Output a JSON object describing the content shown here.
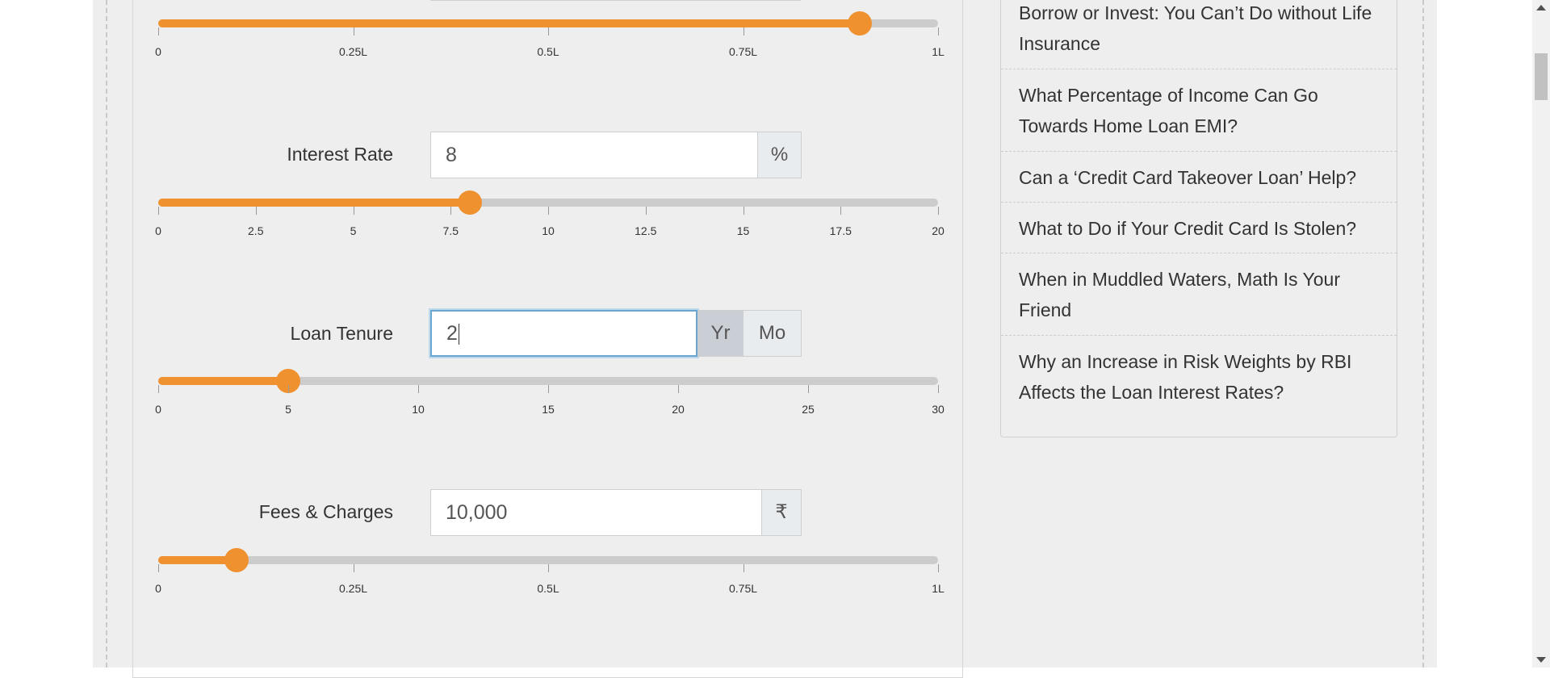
{
  "sliders": [
    {
      "id": "loan-amount",
      "label": "",
      "value_fraction": 0.9,
      "ticks": [
        "0",
        "0.25L",
        "0.5L",
        "0.75L",
        "1L"
      ]
    },
    {
      "id": "interest-rate",
      "label": "Interest Rate",
      "input_value": "8",
      "addon": "%",
      "value_fraction": 0.4,
      "ticks": [
        "0",
        "2.5",
        "5",
        "7.5",
        "10",
        "12.5",
        "15",
        "17.5",
        "20"
      ]
    },
    {
      "id": "loan-tenure",
      "label": "Loan Tenure",
      "input_value": "2",
      "addon_year": "Yr",
      "addon_month": "Mo",
      "value_fraction": 0.1667,
      "ticks": [
        "0",
        "5",
        "10",
        "15",
        "20",
        "25",
        "30"
      ]
    },
    {
      "id": "fees-charges",
      "label": "Fees & Charges",
      "input_value": "10,000",
      "addon": "₹",
      "value_fraction": 0.1,
      "ticks": [
        "0",
        "0.25L",
        "0.5L",
        "0.75L",
        "1L"
      ]
    }
  ],
  "sidebar": {
    "articles": [
      "Borrow or Invest: You Can’t Do without Life Insurance",
      "What Percentage of Income Can Go Towards Home Loan EMI?",
      "Can a ‘Credit Card Takeover Loan’ Help?",
      "What to Do if Your Credit Card Is Stolen?",
      "When in Muddled Waters, Math Is Your Friend",
      "Why an Increase in Risk Weights by RBI Affects the Loan Interest Rates?"
    ]
  },
  "colors": {
    "accent": "#f0912f",
    "track": "#cccccc",
    "page_bg": "#eeeeee",
    "focus_border": "#6aa6d0"
  }
}
